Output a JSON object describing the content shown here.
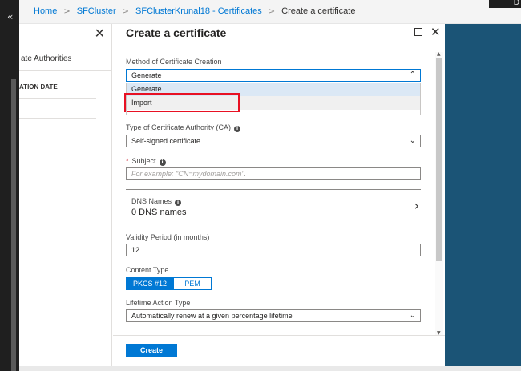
{
  "left_nav": {
    "collapse_glyph": "«"
  },
  "topbar": {
    "corner_text": "D"
  },
  "breadcrumb": {
    "items": [
      "Home",
      "SFCluster",
      "SFClusterKrunal18 - Certificates"
    ],
    "current": "Create a certificate",
    "separator": ">"
  },
  "background_blade": {
    "close_glyph": "✕",
    "tab_label": "ate Authorities",
    "column_header": "ATION DATE"
  },
  "blade": {
    "title": "Create a certificate",
    "close_glyph": "✕",
    "method": {
      "label": "Method of Certificate Creation",
      "value": "Generate",
      "options": [
        "Generate",
        "Import"
      ]
    },
    "ca_type": {
      "label": "Type of Certificate Authority (CA)",
      "value": "Self-signed certificate"
    },
    "subject": {
      "label": "Subject",
      "placeholder": "For example: \"CN=mydomain.com\"."
    },
    "dns": {
      "label": "DNS Names",
      "value": "0 DNS names"
    },
    "validity": {
      "label": "Validity Period (in months)",
      "value": "12"
    },
    "content_type": {
      "label": "Content Type",
      "options": [
        "PKCS #12",
        "PEM"
      ],
      "selected": "PKCS #12"
    },
    "lifetime": {
      "label": "Lifetime Action Type",
      "value": "Automatically renew at a given percentage lifetime"
    },
    "create_label": "Create"
  },
  "colors": {
    "accent": "#0078d4",
    "highlight_box": "#e81123",
    "right_panel": "#1b5476"
  },
  "icons": {
    "info": "info-icon",
    "chevron_down": "chevron-down-icon",
    "chevron_up": "chevron-up-icon",
    "chevron_right": "chevron-right-icon"
  }
}
